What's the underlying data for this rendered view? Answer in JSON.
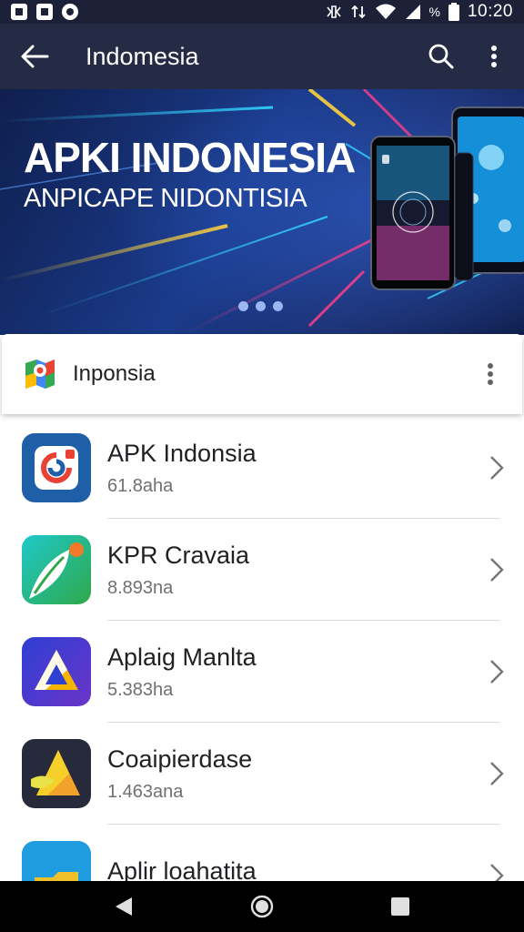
{
  "status_bar": {
    "time": "10:20",
    "icons": [
      "photo-icon",
      "notification-icon",
      "circle-icon"
    ],
    "right_icons": [
      "vibrate-icon",
      "data-icon",
      "wifi-icon",
      "signal-icon",
      "battery-icon"
    ],
    "percent_label": "%"
  },
  "app_bar": {
    "title": "Indomesia",
    "icons": [
      "back-arrow-icon",
      "search-icon",
      "more-vert-icon"
    ]
  },
  "banner": {
    "title": "APKI INDONESIA",
    "subtitle": "ANPICAPE NIDONTISIA",
    "page_indicator_count": 3
  },
  "card": {
    "title": "Inponsia",
    "icon": "maps-logo-icon"
  },
  "apps": [
    {
      "name": "APK Indonsia",
      "size": "61.8aha",
      "icon": "app-swirl-icon",
      "colors": [
        "#1f5fa8",
        "#e94235"
      ]
    },
    {
      "name": "KPR Cravaia",
      "size": "8.893na",
      "icon": "app-leaf-icon",
      "colors": [
        "#1ec8c8",
        "#2ea84a"
      ]
    },
    {
      "name": "Aplaig Manlta",
      "size": "5.383ha",
      "icon": "app-triangle-icon",
      "colors": [
        "#2e3fd4",
        "#6b34c8"
      ]
    },
    {
      "name": "Coaipierdase",
      "size": "1.463ana",
      "icon": "app-prism-icon",
      "colors": [
        "#262a3a",
        "#f2a22a"
      ]
    },
    {
      "name": "Aplir loahatita",
      "size": "",
      "icon": "app-folder-icon",
      "colors": [
        "#1f9be0",
        "#f0c02a"
      ]
    }
  ],
  "colors": {
    "app_bar": "#252a45",
    "status_bar": "#1d2138",
    "nav_bar": "#000000"
  },
  "nav_bar": {
    "icons": [
      "nav-back-icon",
      "nav-home-icon",
      "nav-recents-icon"
    ]
  }
}
